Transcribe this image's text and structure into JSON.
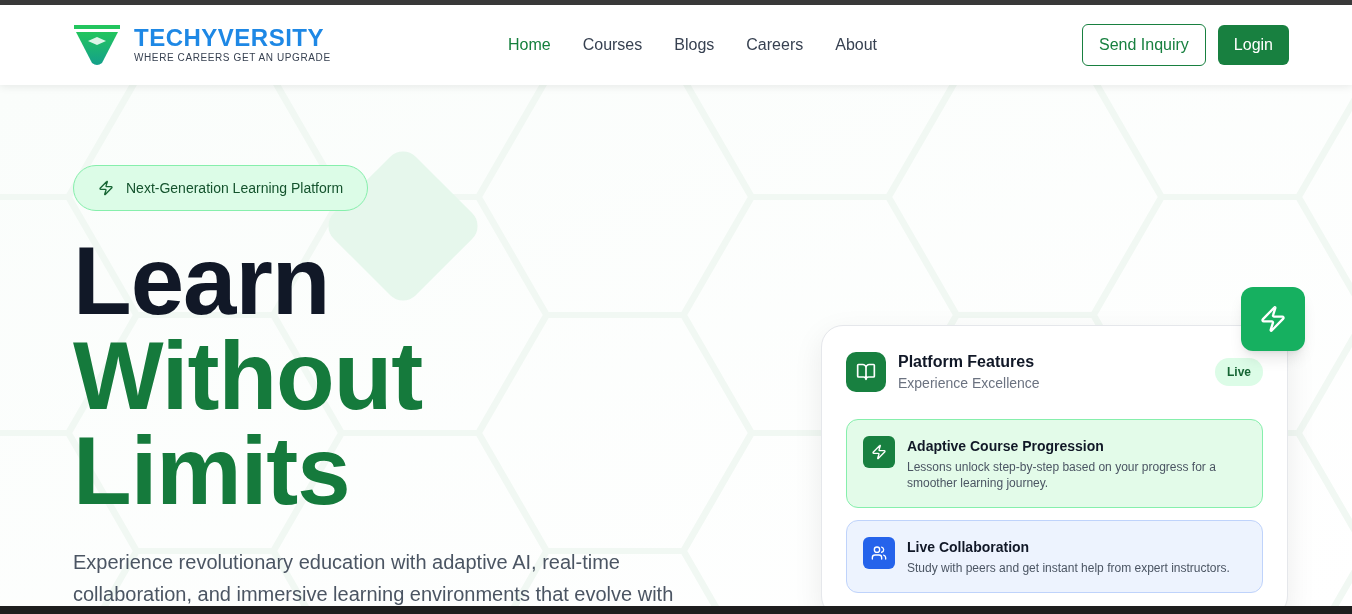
{
  "header": {
    "brand": "TECHYVERSITY",
    "tagline": "WHERE CAREERS GET AN UPGRADE",
    "nav": [
      {
        "label": "Home",
        "selected": true
      },
      {
        "label": "Courses",
        "selected": false
      },
      {
        "label": "Blogs",
        "selected": false
      },
      {
        "label": "Careers",
        "selected": false
      },
      {
        "label": "About",
        "selected": false
      }
    ],
    "buttons": [
      {
        "label": "Send Inquiry",
        "kind": "outline"
      },
      {
        "label": "Login",
        "kind": "solid"
      }
    ]
  },
  "hero": {
    "badge": "Next-Generation Learning Platform",
    "heading": [
      {
        "text": "Learn",
        "kind": "dark"
      },
      {
        "text": "Without",
        "kind": "accent"
      },
      {
        "text": "Limits",
        "kind": "accent"
      }
    ],
    "paragraph": "Experience revolutionary education with adaptive AI, real-time collaboration, and immersive learning environments that evolve with"
  },
  "card": {
    "title": "Platform Features",
    "subtitle": "Experience Excellence",
    "status": "Live",
    "features": [
      {
        "title": "Adaptive Course Progression",
        "text": "Lessons unlock step-by-step based on your progress for a smoother learning journey.",
        "kind": "green"
      },
      {
        "title": "Live Collaboration",
        "text": "Study with peers and get instant help from expert instructors.",
        "kind": "blue"
      }
    ]
  }
}
